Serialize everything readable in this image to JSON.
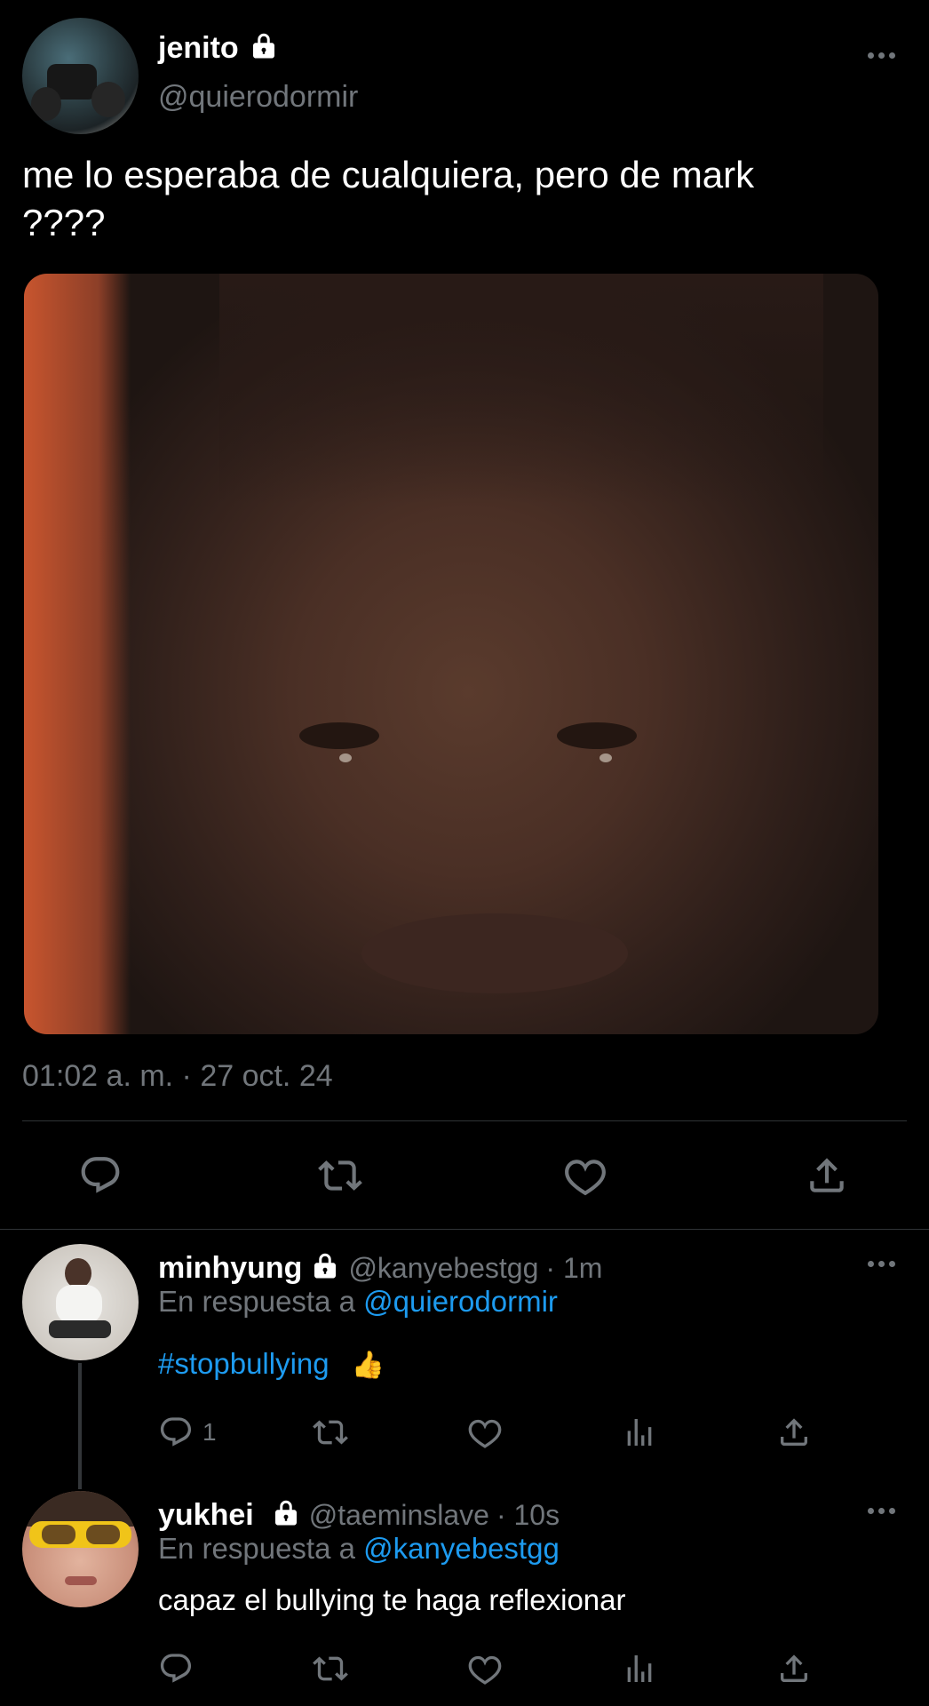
{
  "main_tweet": {
    "display_name": "jenito",
    "handle": "@quierodormir",
    "text": "me lo esperaba de cualquiera, pero de mark ????",
    "timestamp": "01:02 a. m. · 27 oct. 24"
  },
  "replies": [
    {
      "display_name": "minhyung",
      "handle": "@kanyebestgg",
      "time": "· 1m",
      "reply_prefix": "En respuesta a",
      "reply_to": "@quierodormir",
      "text": "#stopbullying",
      "emoji": "👍",
      "reply_count": "1"
    },
    {
      "display_name": "yukhei",
      "handle": "@taeminslave",
      "time": "· 10s",
      "reply_prefix": "En respuesta a",
      "reply_to": "@kanyebestgg",
      "text": "capaz el bullying te haga reflexionar"
    }
  ],
  "icons": {
    "lock": "lock-icon",
    "more": "more-icon",
    "reply": "reply-icon",
    "retweet": "retweet-icon",
    "like": "like-icon",
    "views": "views-icon",
    "share": "share-icon"
  },
  "colors": {
    "background": "#000000",
    "link": "#1d9bf0",
    "muted": "#71767b",
    "divider": "#2f3336"
  }
}
